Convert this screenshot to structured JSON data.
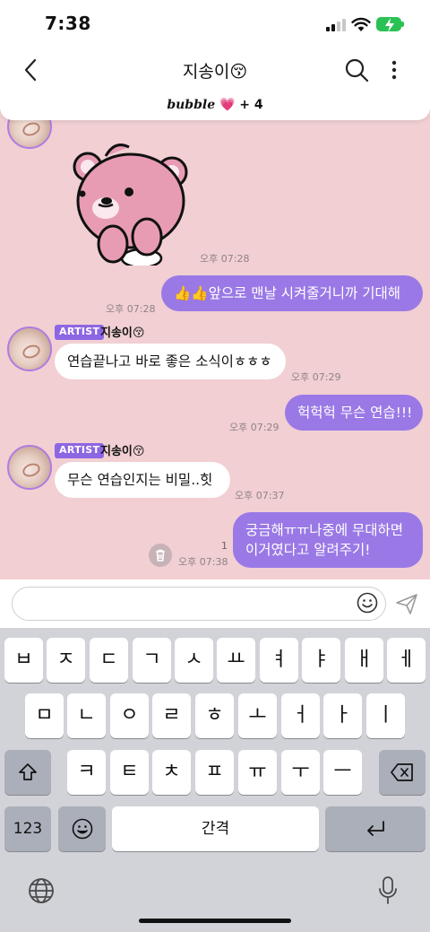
{
  "status": {
    "time": "7:38"
  },
  "header": {
    "title": "지송이😚"
  },
  "bubble_bar": {
    "brand": "bubble",
    "heart": "💗",
    "plus": "+ 4"
  },
  "messages": [
    {
      "side": "out",
      "text": "👍👍앞으로 맨날 시켜줄거니까 기대해",
      "time": "오후 07:28"
    },
    {
      "side": "in",
      "badge": "ARTIST",
      "sender": "지송이😚",
      "text": "연습끝나고 바로 좋은 소식이ㅎㅎㅎ",
      "time": "오후 07:29"
    },
    {
      "side": "out",
      "text": "헉헉헉 무슨 연습!!!",
      "time": "오후 07:29"
    },
    {
      "side": "in",
      "badge": "ARTIST",
      "sender": "지송이😚",
      "text": "무슨 연습인지는 비밀..힛",
      "time": "오후 07:37"
    },
    {
      "side": "out",
      "text": "궁금해ㅠㅠ나중에 무대하면 이거였다고 알려주기!",
      "time": "오후 07:38",
      "unread": "1"
    }
  ],
  "sticker_time": "오후 07:28",
  "input": {
    "placeholder": ""
  },
  "keyboard": {
    "row1": [
      "ㅂ",
      "ㅈ",
      "ㄷ",
      "ㄱ",
      "ㅅ",
      "ㅛ",
      "ㅕ",
      "ㅑ",
      "ㅐ",
      "ㅔ"
    ],
    "row2": [
      "ㅁ",
      "ㄴ",
      "ㅇ",
      "ㄹ",
      "ㅎ",
      "ㅗ",
      "ㅓ",
      "ㅏ",
      "ㅣ"
    ],
    "row3": [
      "ㅋ",
      "ㅌ",
      "ㅊ",
      "ㅍ",
      "ㅠ",
      "ㅜ",
      "ㅡ"
    ],
    "numbers": "123",
    "space": "간격"
  },
  "colors": {
    "chat_bg": "#f1cfd2",
    "outgoing": "#9a79e6",
    "badge": "#8d66e3",
    "battery": "#2bc255"
  },
  "icons": [
    "back-icon",
    "search-icon",
    "more-icon",
    "heart-icon",
    "trash-icon",
    "emoji-icon",
    "send-icon",
    "shift-icon",
    "backspace-icon",
    "return-icon",
    "globe-icon",
    "mic-icon"
  ]
}
